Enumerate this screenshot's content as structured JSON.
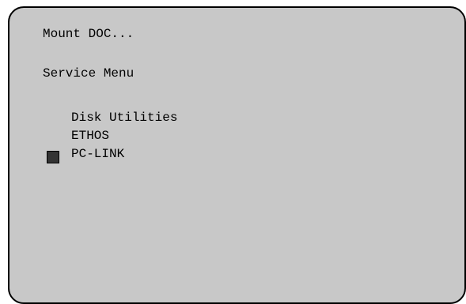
{
  "screen": {
    "status_text": "Mount DOC...",
    "menu_title": "Service Menu",
    "menu_items": [
      {
        "label": "Disk Utilities"
      },
      {
        "label": "ETHOS"
      },
      {
        "label": "PC-LINK",
        "selected": true
      }
    ],
    "colors": {
      "background": "#c8c8c8",
      "text": "#000000",
      "cursor": "#333333"
    },
    "cursor_icon": "selection-block-icon"
  }
}
